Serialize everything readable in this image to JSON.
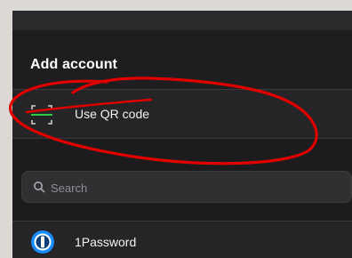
{
  "header": {
    "title": "Add account"
  },
  "options": {
    "qr": {
      "label": "Use QR code",
      "icon": "qr-scan-icon"
    }
  },
  "search": {
    "placeholder": "Search",
    "icon": "search-icon"
  },
  "apps": [
    {
      "name": "1Password",
      "icon": "onepassword-logo-icon"
    }
  ],
  "colors": {
    "background": "#1c1c1e",
    "row": "#252527",
    "annotation": "#e00000"
  }
}
